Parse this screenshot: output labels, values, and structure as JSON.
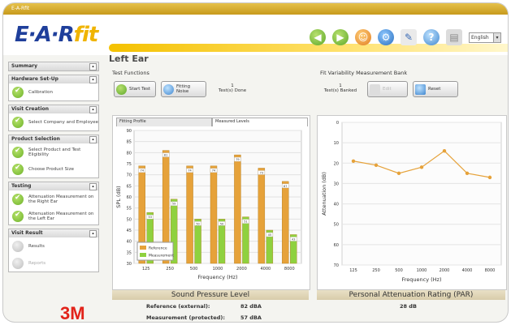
{
  "window": {
    "title": "E-A-Rfit"
  },
  "logo": {
    "ear": "E·A·R",
    "fit": "fit"
  },
  "brand": {
    "name": "3M"
  },
  "language": {
    "selected": "English"
  },
  "sidebar": {
    "groups": [
      {
        "title": "Summary",
        "steps": []
      },
      {
        "title": "Hardware Set-Up",
        "steps": [
          {
            "label": "Calibration",
            "done": true
          }
        ]
      },
      {
        "title": "Visit Creation",
        "steps": [
          {
            "label": "Select Company and Employee",
            "done": true
          }
        ]
      },
      {
        "title": "Product Selection",
        "steps": [
          {
            "label": "Select Product and Test Eligibility",
            "done": true
          },
          {
            "label": "Choose Product Size",
            "done": true
          }
        ]
      },
      {
        "title": "Testing",
        "steps": [
          {
            "label": "Attenuation Measurement on the Right Ear",
            "done": true
          },
          {
            "label": "Attenuation Measurement on the Left Ear",
            "done": true
          }
        ]
      },
      {
        "title": "Visit Result",
        "steps": [
          {
            "label": "Results",
            "done": false
          },
          {
            "label": "Reports",
            "done": false
          }
        ]
      }
    ]
  },
  "main": {
    "page_title": "Left Ear",
    "test_functions": {
      "label": "Test Functions",
      "start_test": "Start Test",
      "fitting_noise": "Fitting Noise",
      "tests_done_count": "1",
      "tests_done_label": "Test(s) Done"
    },
    "bank": {
      "label": "Fit Variability Measurement Bank",
      "banked_count": "1",
      "banked_label": "Test(s) Banked",
      "edit": "Edit",
      "reset": "Reset"
    },
    "tabs": [
      "Fitting Profile",
      "Measured Levels"
    ],
    "spl": {
      "title": "Sound Pressure Level",
      "reference_label": "Reference (external):",
      "reference_value": "82 dBA",
      "measurement_label": "Measurement (protected):",
      "measurement_value": "57 dBA"
    },
    "par": {
      "title": "Personal Attenuation Rating (PAR)",
      "value": "28 dB"
    }
  },
  "chart_data": [
    {
      "type": "bar",
      "categories": [
        "125",
        "250",
        "500",
        "1000",
        "2000",
        "4000",
        "8000"
      ],
      "series": [
        {
          "name": "Reference",
          "values": [
            74,
            81,
            74,
            74,
            79,
            73,
            67
          ],
          "color": "#e6a23a"
        },
        {
          "name": "Measurement",
          "values": [
            53,
            59,
            50,
            50,
            51,
            45,
            43
          ],
          "color": "#8fd13f"
        }
      ],
      "data_labels": {
        "Reference": [
          "74",
          "81",
          "74",
          "74",
          "79",
          "73",
          "67"
        ],
        "Measurement": [
          "53",
          "59",
          "50",
          "50",
          "51",
          "45",
          "43"
        ]
      },
      "xlabel": "Frequency (Hz)",
      "ylabel": "SPL (dB)",
      "ylim": [
        30,
        90
      ],
      "yticks": [
        "30",
        "35",
        "40",
        "45",
        "50",
        "55",
        "60",
        "65",
        "70",
        "75",
        "80",
        "85",
        "90"
      ],
      "legend": "bottom-left",
      "grid": true
    },
    {
      "type": "line",
      "categories": [
        "125",
        "250",
        "500",
        "1000",
        "2000",
        "4000",
        "8000"
      ],
      "series": [
        {
          "values": [
            19,
            21,
            25,
            22,
            14,
            25,
            27
          ],
          "color": "#e6a23a"
        }
      ],
      "xlabel": "Frequency (Hz)",
      "ylabel": "Attenuation (dB)",
      "ylim": [
        0,
        70
      ],
      "yticks": [
        "0",
        "10",
        "20",
        "30",
        "40",
        "50",
        "60",
        "70"
      ],
      "y_inverted": true,
      "grid": true
    }
  ]
}
